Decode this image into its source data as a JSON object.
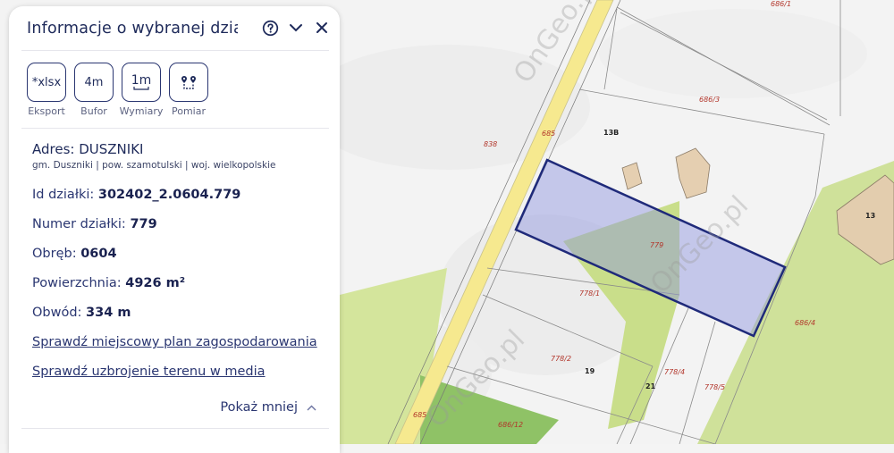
{
  "panel": {
    "title": "Informacje o wybranej dział…",
    "tools": [
      {
        "label": "Eksport",
        "glyph": "*xlsx",
        "icon": "export-xlsx-icon"
      },
      {
        "label": "Bufor",
        "glyph": "4m",
        "icon": "buffer-icon"
      },
      {
        "label": "Wymiary",
        "glyph": "1m",
        "icon": "dimensions-icon"
      },
      {
        "label": "Pomiar",
        "glyph": "",
        "icon": "measure-route-icon"
      }
    ],
    "address": {
      "title": "Adres: DUSZNIKI",
      "sub": "gm. Duszniki | pow. szamotulski | woj. wielkopolskie"
    },
    "fields": {
      "id_label": "Id działki:",
      "id_value": "302402_2.0604.779",
      "number_label": "Numer działki:",
      "number_value": "779",
      "precinct_label": "Obręb:",
      "precinct_value": "0604",
      "area_label": "Powierzchnia:",
      "area_value": "4926 m²",
      "perimeter_label": "Obwód:",
      "perimeter_value": "334 m"
    },
    "links": {
      "plan": "Sprawdź miejscowy plan zagospodarowania",
      "utilities": "Sprawdź uzbrojenie terenu w media"
    },
    "show_less": "Pokaż mniej"
  },
  "map": {
    "parcel_labels": [
      "686/1",
      "686/3",
      "685",
      "838",
      "13B",
      "779",
      "778/1",
      "686/4",
      "778/2",
      "19",
      "778/4",
      "21",
      "778/5",
      "685",
      "686/12"
    ],
    "house_numbers": [
      "13B",
      "13",
      "19",
      "21"
    ],
    "watermark": "OnGeo.pl",
    "colors": {
      "selected_outline": "#1f2a7a",
      "selected_fill": "#8c93e0",
      "road": "#f6e98f",
      "green_area": "#c9de8a",
      "parcel_label": "#b2352a"
    }
  }
}
